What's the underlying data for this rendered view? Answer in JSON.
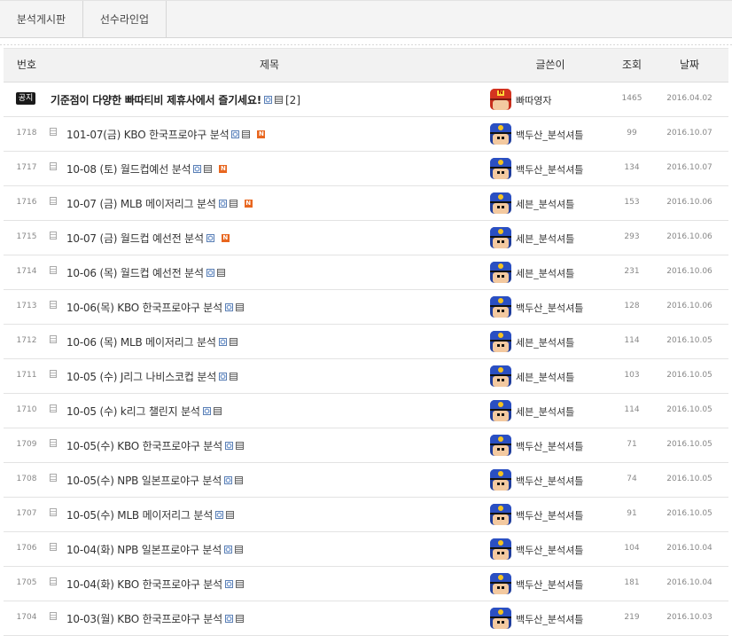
{
  "tabs": [
    "분석게시판",
    "선수라인업"
  ],
  "headers": {
    "no": "번호",
    "title": "제목",
    "author": "글쓴이",
    "views": "조회",
    "date": "날짜"
  },
  "notice": {
    "badge": "공지",
    "title": "기준점이 다양한 빠따티비 제휴사에서 즐기세요!",
    "comments": "[2]",
    "author": "빠따영자",
    "views": "1465",
    "date": "2016.04.02",
    "avatar_icon": "red-cap-n"
  },
  "colors": {
    "new_badge": "#e8661f",
    "notice_badge_bg": "#1a1a1a"
  },
  "new_badge_label": "N",
  "rows": [
    {
      "no": "1718",
      "title": "101-07(금) KBO 한국프로야구 분석",
      "img": true,
      "new": true,
      "author": "백두산_분석셔틀",
      "views": "99",
      "date": "2016.10.07"
    },
    {
      "no": "1717",
      "title": "10-08 (토) 월드컵예선 분석",
      "img": true,
      "new": true,
      "author": "백두산_분석셔틀",
      "views": "134",
      "date": "2016.10.07"
    },
    {
      "no": "1716",
      "title": "10-07 (금) MLB 메이저리그 분석",
      "img": true,
      "new": true,
      "author": "세븐_분석셔틀",
      "views": "153",
      "date": "2016.10.06"
    },
    {
      "no": "1715",
      "title": "10-07 (금) 월드컵 예선전 분석",
      "img": true,
      "new": true,
      "file": false,
      "author": "세븐_분석셔틀",
      "views": "293",
      "date": "2016.10.06"
    },
    {
      "no": "1714",
      "title": "10-06 (목) 월드컵 예선전 분석",
      "img": true,
      "new": false,
      "author": "세븐_분석셔틀",
      "views": "231",
      "date": "2016.10.06"
    },
    {
      "no": "1713",
      "title": "10-06(목) KBO 한국프로야구 분석",
      "img": true,
      "new": false,
      "author": "백두산_분석셔틀",
      "views": "128",
      "date": "2016.10.06"
    },
    {
      "no": "1712",
      "title": "10-06 (목) MLB 메이저리그 분석",
      "img": true,
      "new": false,
      "author": "세븐_분석셔틀",
      "views": "114",
      "date": "2016.10.05"
    },
    {
      "no": "1711",
      "title": "10-05 (수) J리그 나비스코컵 분석",
      "img": true,
      "new": false,
      "author": "세븐_분석셔틀",
      "views": "103",
      "date": "2016.10.05"
    },
    {
      "no": "1710",
      "title": "10-05 (수) k리그 챌린지 분석",
      "img": true,
      "new": false,
      "author": "세븐_분석셔틀",
      "views": "114",
      "date": "2016.10.05"
    },
    {
      "no": "1709",
      "title": "10-05(수) KBO 한국프로야구 분석",
      "img": true,
      "new": false,
      "author": "백두산_분석셔틀",
      "views": "71",
      "date": "2016.10.05"
    },
    {
      "no": "1708",
      "title": "10-05(수) NPB 일본프로야구 분석",
      "img": true,
      "new": false,
      "author": "백두산_분석셔틀",
      "views": "74",
      "date": "2016.10.05"
    },
    {
      "no": "1707",
      "title": "10-05(수) MLB 메이저리그 분석",
      "img": true,
      "new": false,
      "author": "백두산_분석셔틀",
      "views": "91",
      "date": "2016.10.05"
    },
    {
      "no": "1706",
      "title": "10-04(화) NPB 일본프로야구 분석",
      "img": true,
      "new": false,
      "author": "백두산_분석셔틀",
      "views": "104",
      "date": "2016.10.04"
    },
    {
      "no": "1705",
      "title": "10-04(화) KBO 한국프로야구 분석",
      "img": true,
      "new": false,
      "author": "백두산_분석셔틀",
      "views": "181",
      "date": "2016.10.04"
    },
    {
      "no": "1704",
      "title": "10-03(월) KBO 한국프로야구 분석",
      "img": true,
      "new": false,
      "author": "백두산_분석셔틀",
      "views": "219",
      "date": "2016.10.03"
    }
  ]
}
